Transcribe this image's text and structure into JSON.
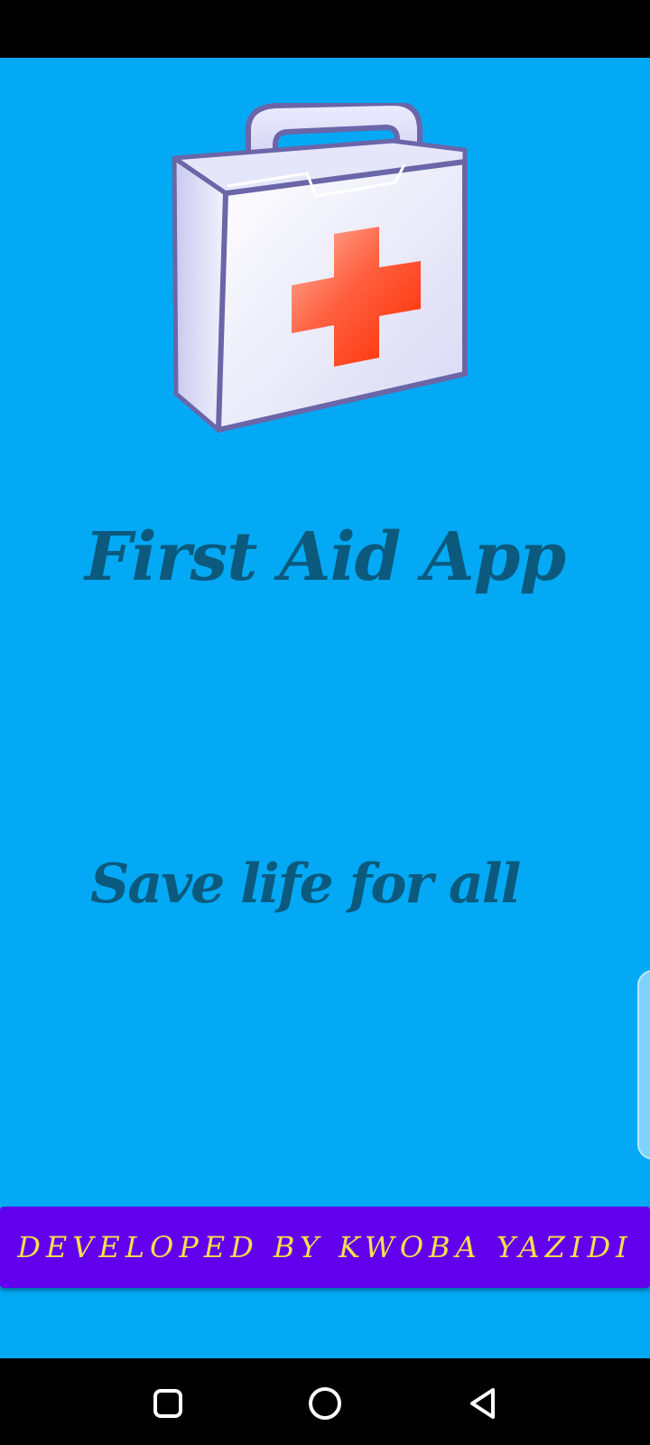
{
  "app": {
    "title": "First Aid App",
    "tagline": "Save life for all"
  },
  "footer": {
    "developer_label": "DEVELOPED BY KWOBA YAZIDI"
  },
  "icons": {
    "logo": "first-aid-kit-icon",
    "nav_recents": "square-icon",
    "nav_home": "circle-icon",
    "nav_back": "triangle-back-icon"
  },
  "colors": {
    "background": "#03A9F4",
    "title_text": "#0B5A7E",
    "button_bg": "#6200EE",
    "button_text": "#F5E04A"
  }
}
